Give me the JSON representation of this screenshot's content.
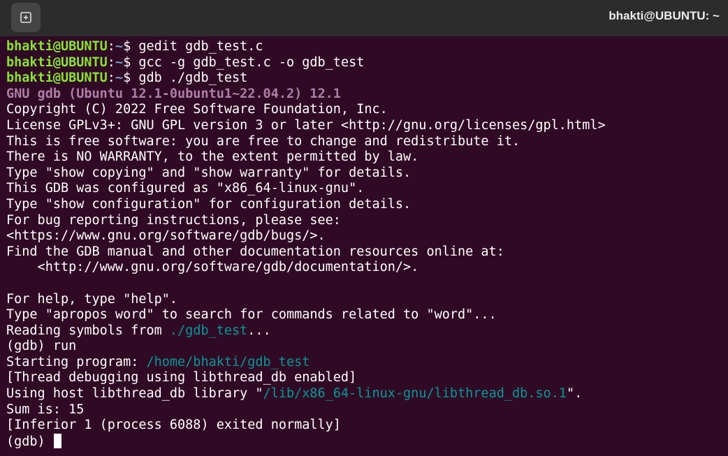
{
  "window": {
    "title": "bhakti@UBUNTU: ~",
    "new_tab_icon": "new-tab-icon"
  },
  "colors": {
    "background": "#300a24",
    "prompt_user": "#8ae234",
    "prompt_path": "#729fcf",
    "gdb_version": "#ad7fa8",
    "path_highlight": "#06989a"
  },
  "terminal": {
    "prompt": {
      "user_host": "bhakti@UBUNTU",
      "colon": ":",
      "path": "~",
      "symbol": "$ "
    },
    "commands": [
      "gedit gdb_test.c",
      "gcc -g gdb_test.c -o gdb_test",
      "gdb ./gdb_test"
    ],
    "gdb_version": "GNU gdb (Ubuntu 12.1-0ubuntu1~22.04.2) 12.1",
    "banner": [
      "Copyright (C) 2022 Free Software Foundation, Inc.",
      "License GPLv3+: GNU GPL version 3 or later <http://gnu.org/licenses/gpl.html>",
      "This is free software: you are free to change and redistribute it.",
      "There is NO WARRANTY, to the extent permitted by law.",
      "Type \"show copying\" and \"show warranty\" for details.",
      "This GDB was configured as \"x86_64-linux-gnu\".",
      "Type \"show configuration\" for configuration details.",
      "For bug reporting instructions, please see:",
      "<https://www.gnu.org/software/gdb/bugs/>.",
      "Find the GDB manual and other documentation resources online at:",
      "    <http://www.gnu.org/software/gdb/documentation/>.",
      "",
      "For help, type \"help\".",
      "Type \"apropos word\" to search for commands related to \"word\"..."
    ],
    "reading_symbols": {
      "prefix": "Reading symbols from ",
      "path": "./gdb_test",
      "suffix": "..."
    },
    "gdb_run": "(gdb) run",
    "starting_program": {
      "prefix": "Starting program: ",
      "path": "/home/bhakti/gdb_test"
    },
    "thread_debug": "[Thread debugging using libthread_db enabled]",
    "using_host": {
      "prefix": "Using host libthread_db library \"",
      "path": "/lib/x86_64-linux-gnu/libthread_db.so.1",
      "suffix": "\"."
    },
    "sum_output": "Sum is: 15",
    "inferior_exit": "[Inferior 1 (process 6088) exited normally]",
    "gdb_prompt": "(gdb) "
  }
}
